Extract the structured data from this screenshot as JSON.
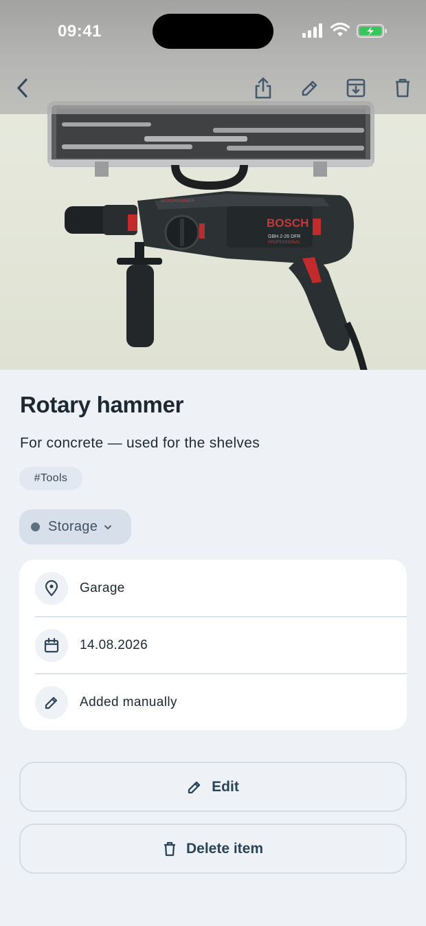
{
  "status_bar": {
    "time": "09:41"
  },
  "toolbar": {
    "back_icon": "chevron-left-icon",
    "share_icon": "share-icon",
    "edit_icon": "pencil-icon",
    "archive_icon": "archive-icon",
    "delete_icon": "trash-icon"
  },
  "hero": {
    "brand_text": "BOSCH",
    "model_text": "GBH 2-26 DFR",
    "model_sub": "PROFESSIONAL",
    "top_label": "BOSCHHAMMER"
  },
  "item": {
    "title": "Rotary hammer",
    "description": "For concrete — used for the shelves",
    "tag": "#Tools",
    "status": "Storage"
  },
  "details": {
    "location": "Garage",
    "date": "14.08.2026",
    "source": "Added manually"
  },
  "actions": {
    "edit_label": "Edit",
    "delete_label": "Delete item"
  },
  "colors": {
    "background": "#eef2f7",
    "accent": "#2b4358",
    "status_dot": "#5d7081",
    "battery": "#34c759"
  }
}
